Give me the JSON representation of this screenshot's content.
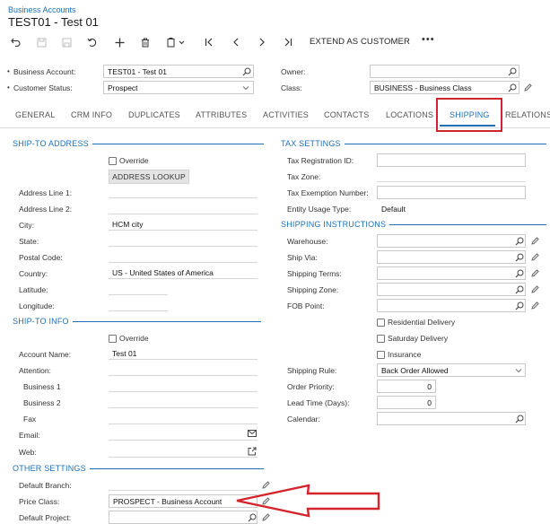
{
  "header": {
    "breadcrumb": "Business Accounts",
    "title": "TEST01 - Test 01",
    "extend_label": "EXTEND AS CUSTOMER",
    "more_label": "•••"
  },
  "summary": {
    "business_account_label": "Business Account:",
    "business_account_value": "TEST01 - Test 01",
    "customer_status_label": "Customer Status:",
    "customer_status_value": "Prospect",
    "owner_label": "Owner:",
    "owner_value": "",
    "class_label": "Class:",
    "class_value": "BUSINESS - Business Class"
  },
  "tabs": [
    "GENERAL",
    "CRM INFO",
    "DUPLICATES",
    "ATTRIBUTES",
    "ACTIVITIES",
    "CONTACTS",
    "LOCATIONS",
    "SHIPPING",
    "RELATIONS"
  ],
  "active_tab": "SHIPPING",
  "ship_to_address": {
    "section_title": "SHIP-TO ADDRESS",
    "override_label": "Override",
    "override_checked": false,
    "lookup_button": "ADDRESS LOOKUP",
    "address_line1_label": "Address Line 1:",
    "address_line2_label": "Address Line 2:",
    "city_label": "City:",
    "city_value": "HCM city",
    "state_label": "State:",
    "postal_label": "Postal Code:",
    "country_label": "Country:",
    "country_value": "US - United States of America",
    "latitude_label": "Latitude:",
    "longitude_label": "Longitude:"
  },
  "ship_to_info": {
    "section_title": "SHIP-TO INFO",
    "override_label": "Override",
    "override_checked": false,
    "account_name_label": "Account Name:",
    "account_name_value": "Test 01",
    "attention_label": "Attention:",
    "business1_label": "Business 1",
    "business2_label": "Business 2",
    "fax_label": "Fax",
    "email_label": "Email:",
    "web_label": "Web:"
  },
  "other_settings": {
    "section_title": "OTHER SETTINGS",
    "default_branch_label": "Default Branch:",
    "price_class_label": "Price Class:",
    "price_class_value": "PROSPECT - Business Account",
    "default_project_label": "Default Project:"
  },
  "tax_settings": {
    "section_title": "TAX SETTINGS",
    "tax_registration_label": "Tax Registration ID:",
    "tax_zone_label": "Tax Zone:",
    "tax_exemption_label": "Tax Exemption Number:",
    "entity_usage_label": "Entity Usage Type:",
    "entity_usage_value": "Default"
  },
  "shipping_instructions": {
    "section_title": "SHIPPING INSTRUCTIONS",
    "warehouse_label": "Warehouse:",
    "ship_via_label": "Ship Via:",
    "shipping_terms_label": "Shipping Terms:",
    "shipping_zone_label": "Shipping Zone:",
    "fob_point_label": "FOB Point:",
    "residential_label": "Residential Delivery",
    "saturday_label": "Saturday Delivery",
    "insurance_label": "Insurance",
    "shipping_rule_label": "Shipping Rule:",
    "shipping_rule_value": "Back Order Allowed",
    "order_priority_label": "Order Priority:",
    "order_priority_value": "0",
    "lead_time_label": "Lead Time (Days):",
    "lead_time_value": "0",
    "calendar_label": "Calendar:"
  },
  "colors": {
    "accent": "#1f6fb5",
    "highlight": "#d3242b"
  }
}
